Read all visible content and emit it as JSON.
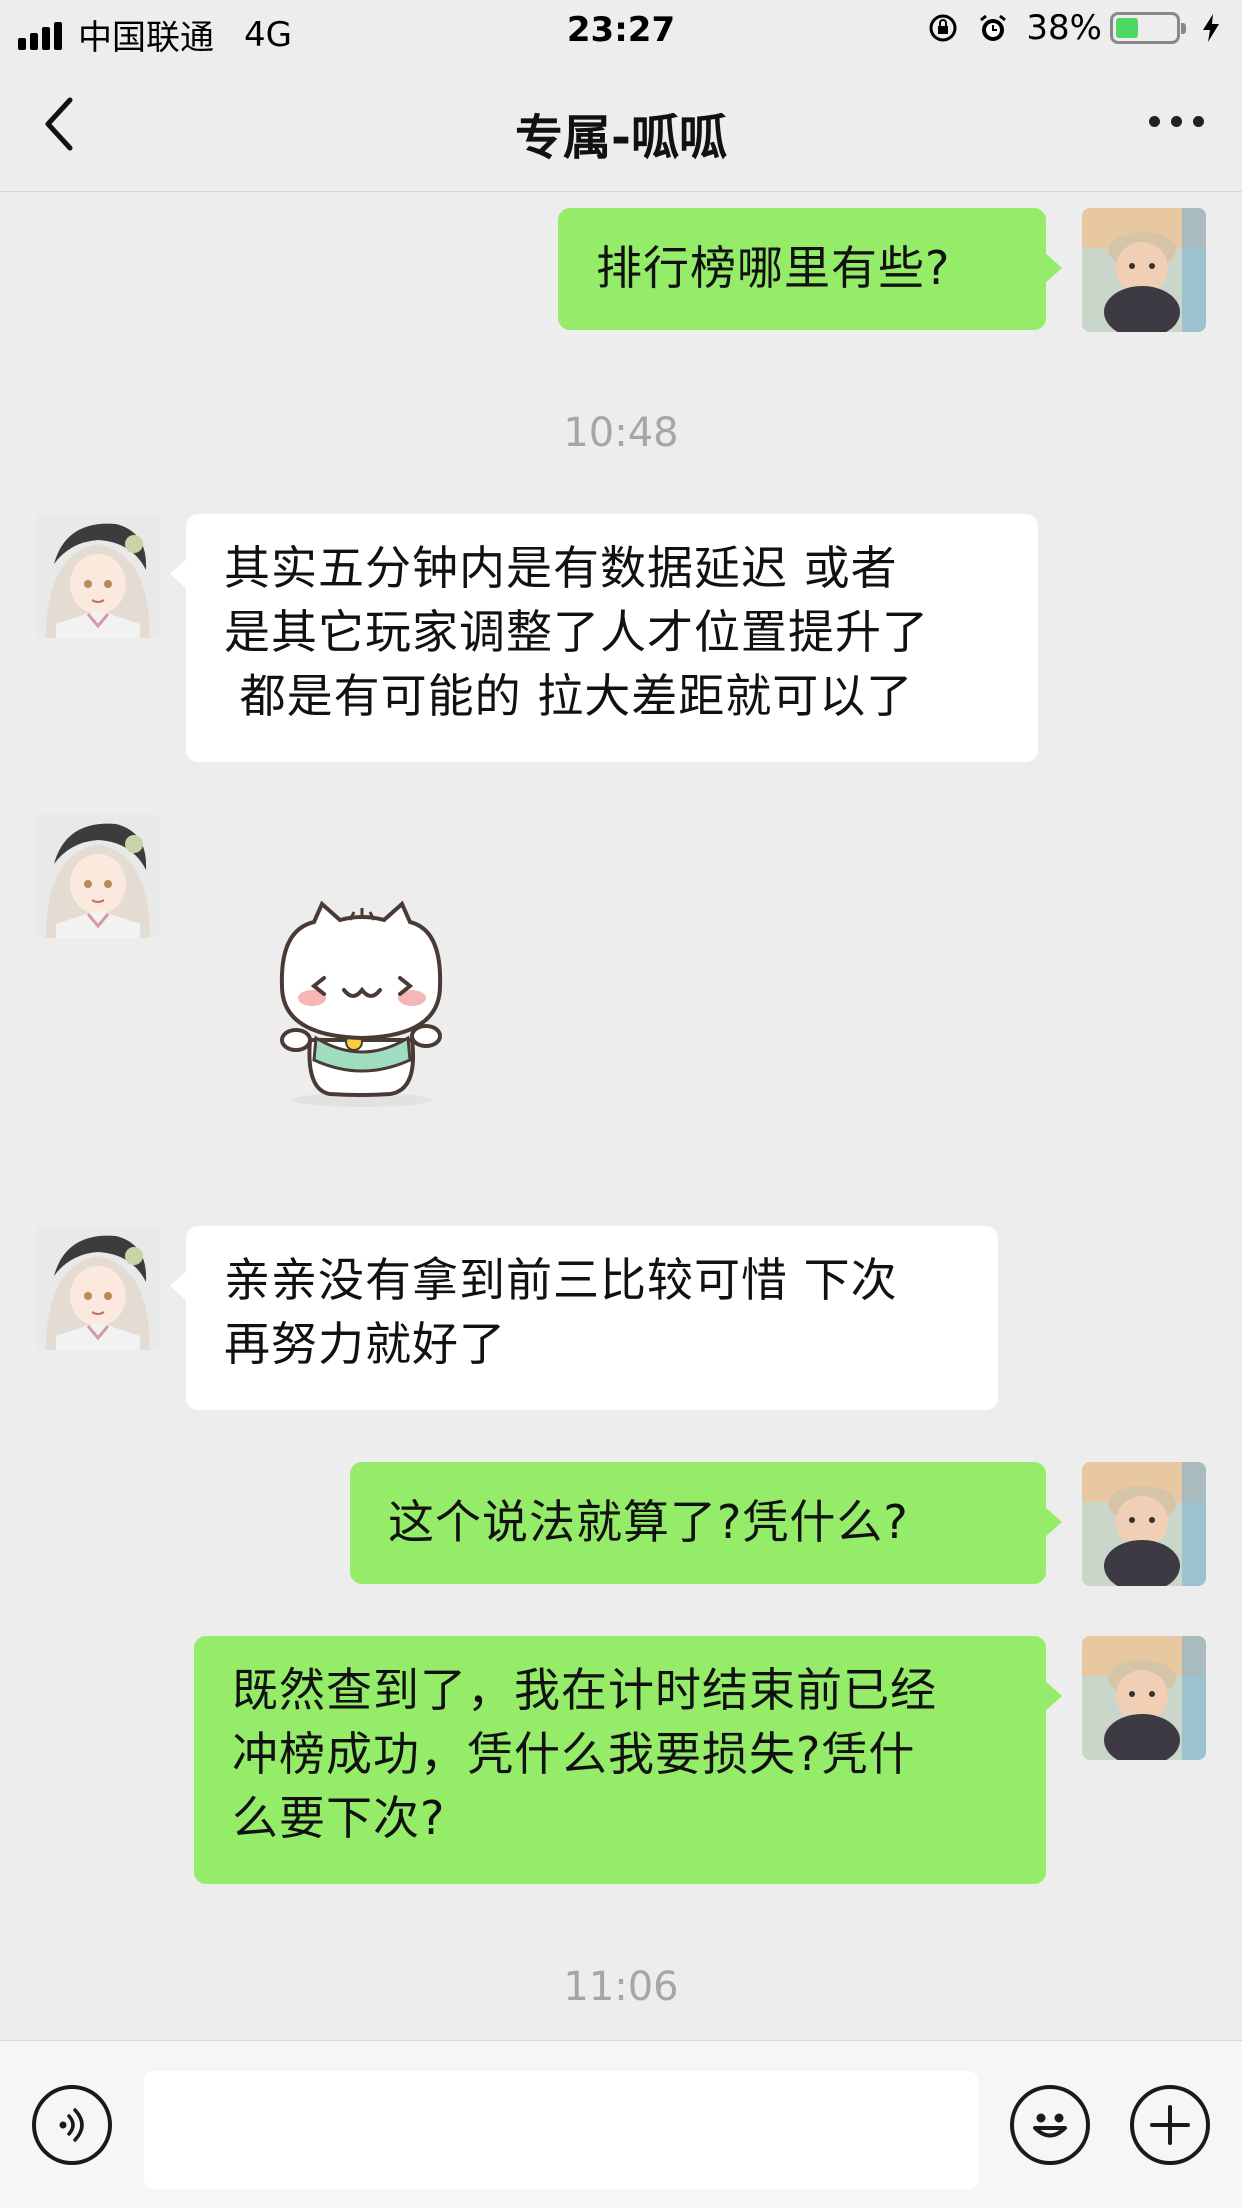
{
  "status_bar": {
    "carrier": "中国联通",
    "network": "4G",
    "time": "23:27",
    "battery_percent": "38%",
    "battery_level": 0.38
  },
  "nav": {
    "title": "专属-呱呱"
  },
  "messages": [
    {
      "side": "right",
      "text": "排行榜哪里有些?"
    },
    {
      "timestamp": "10:48"
    },
    {
      "side": "left",
      "lines": [
        "其实五分钟内是有数据延迟 或者",
        "是其它玩家调整了人才位置提升了",
        " 都是有可能的 拉大差距就可以了"
      ]
    },
    {
      "side": "left",
      "sticker": "white-cat-sticker"
    },
    {
      "side": "left",
      "lines": [
        "亲亲没有拿到前三比较可惜 下次",
        "再努力就好了"
      ]
    },
    {
      "side": "right",
      "text": "这个说法就算了?凭什么?"
    },
    {
      "side": "right",
      "lines": [
        "既然查到了，我在计时结束前已经",
        "冲榜成功，凭什么我要损失?凭什",
        "么要下次?"
      ]
    },
    {
      "timestamp": "11:06"
    }
  ],
  "input_bar": {
    "placeholder": "",
    "icons": [
      "voice-icon",
      "emoji-icon",
      "plus-icon"
    ]
  },
  "colors": {
    "background": "#ededed",
    "bubble_right": "#95ec69",
    "bubble_left": "#ffffff",
    "timestamp": "#a6a6a6"
  }
}
